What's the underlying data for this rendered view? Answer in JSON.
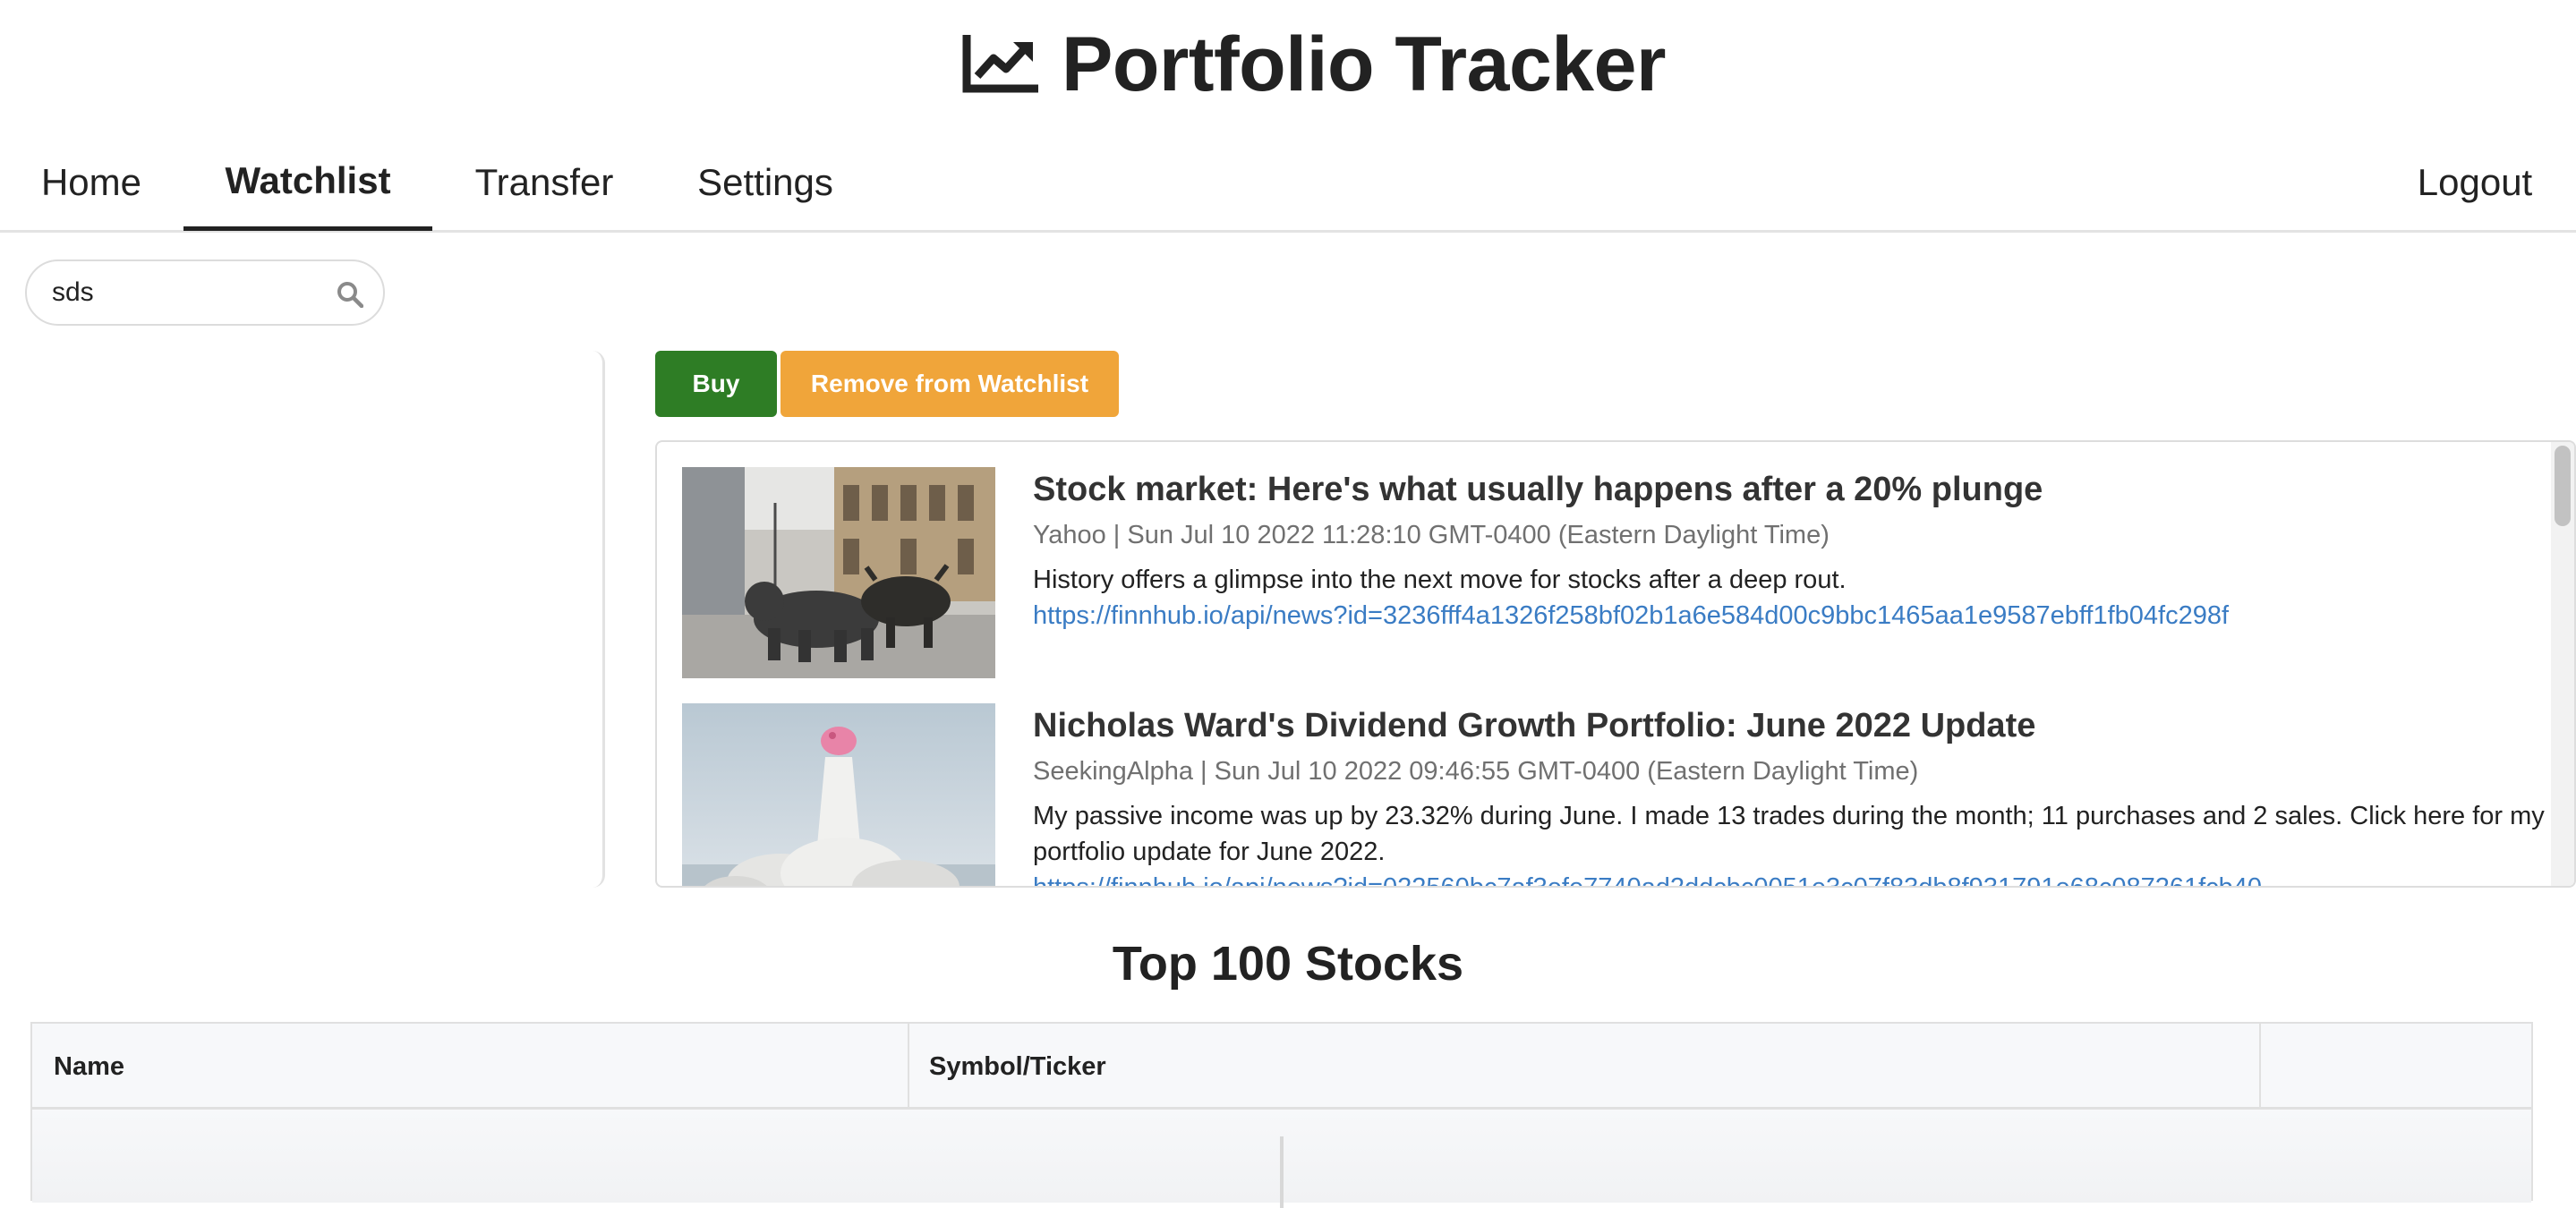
{
  "app": {
    "title": "Portfolio Tracker",
    "logo_icon": "chart-line-up-icon"
  },
  "nav": {
    "items": [
      {
        "label": "Home",
        "active": false
      },
      {
        "label": "Watchlist",
        "active": true
      },
      {
        "label": "Transfer",
        "active": false
      },
      {
        "label": "Settings",
        "active": false
      }
    ],
    "logout_label": "Logout"
  },
  "search": {
    "value": "sds",
    "icon": "search-icon"
  },
  "actions": {
    "buy_label": "Buy",
    "remove_label": "Remove from Watchlist",
    "buy_color": "#2e7d25",
    "remove_color": "#f0a53a"
  },
  "news": {
    "items": [
      {
        "headline": "Stock market: Here's what usually happens after a 20% plunge",
        "meta": "Yahoo | Sun Jul 10 2022 11:28:10 GMT-0400 (Eastern Daylight Time)",
        "summary": "History offers a glimpse into the next move for stocks after a deep rout.",
        "link": "https://finnhub.io/api/news?id=3236fff4a1326f258bf02b1a6e584d00c9bbc1465aa1e9587ebff1fb04fc298f"
      },
      {
        "headline": "Nicholas Ward's Dividend Growth Portfolio: June 2022 Update",
        "meta": "SeekingAlpha | Sun Jul 10 2022 09:46:55 GMT-0400 (Eastern Daylight Time)",
        "summary": "My passive income was up by 23.32% during June. I made 13 trades during the month; 11 purchases and 2 sales. Click here for my portfolio update for June 2022.",
        "link": "https://finnhub.io/api/news?id=022560bc7af3efe7740ad2ddcbc0051e3c07f83db8f931791e68c087261fcb40"
      }
    ]
  },
  "top_stocks": {
    "title": "Top 100 Stocks",
    "columns": [
      "Name",
      "Symbol/Ticker",
      ""
    ]
  }
}
